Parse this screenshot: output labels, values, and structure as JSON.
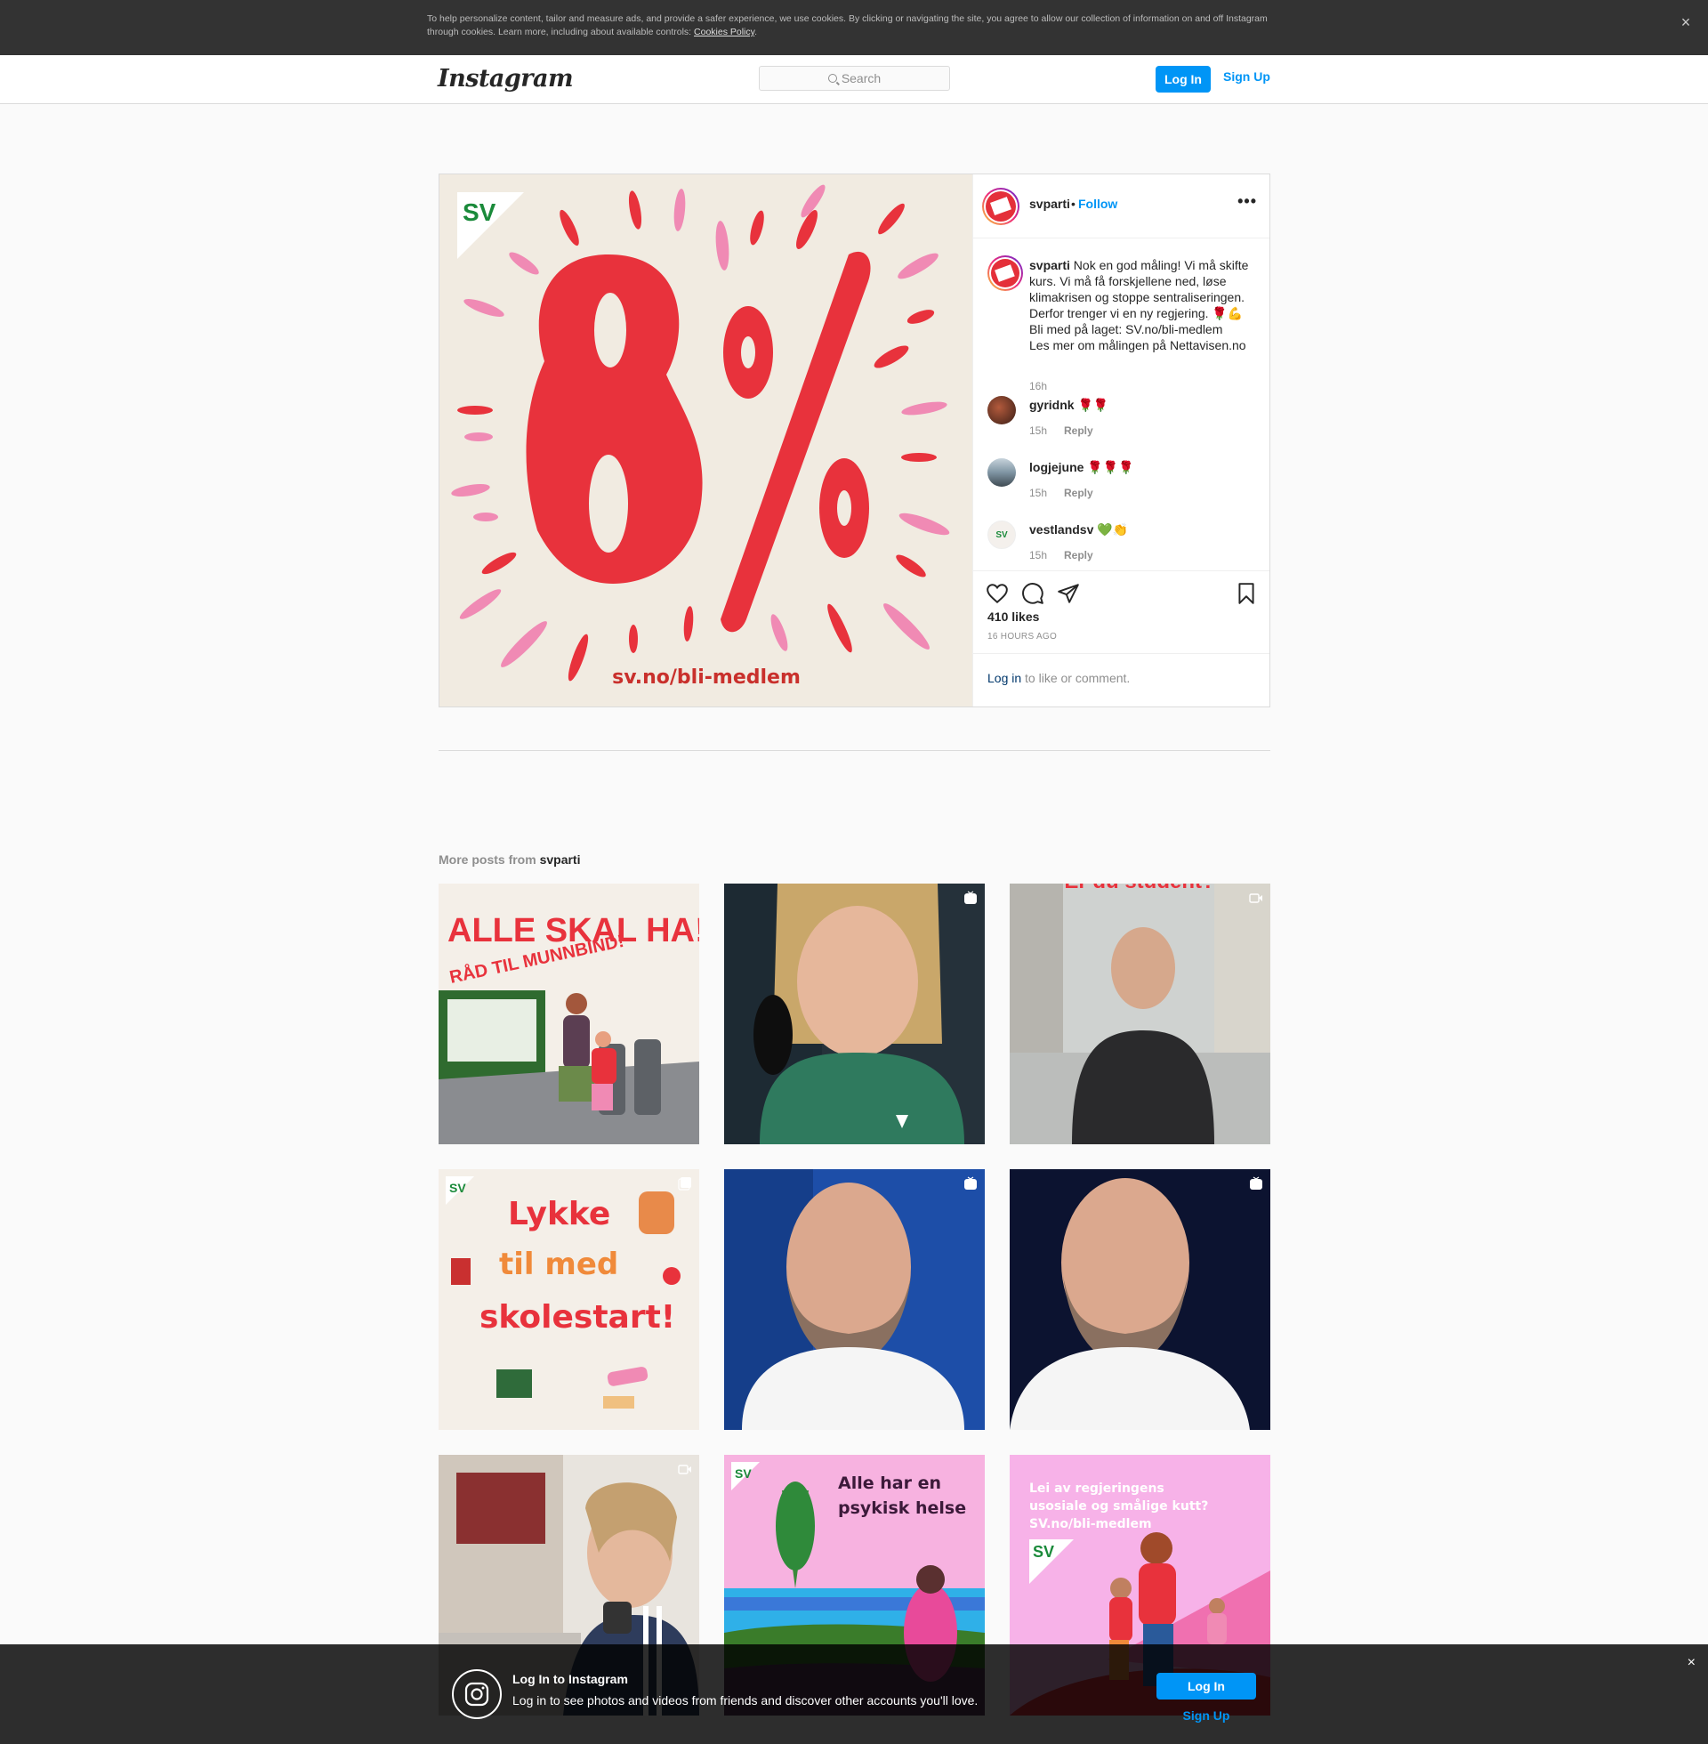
{
  "cookie_bar": {
    "text": "To help personalize content, tailor and measure ads, and provide a safer experience, we use cookies. By clicking or navigating the site, you agree to allow our collection of information on and off Instagram through cookies. Learn more, including about available controls: ",
    "link": "Cookies Policy",
    "end": ".",
    "close": "×"
  },
  "header": {
    "logo": "Instagram",
    "search_placeholder": "Search",
    "login": "Log In",
    "signup": "Sign Up"
  },
  "post": {
    "username": "svparti",
    "dot": "•",
    "follow": "Follow",
    "more": "•••",
    "image": {
      "logo_text": "SV",
      "big_text": "8%",
      "url_text": "sv.no/bli-medlem"
    },
    "caption": {
      "username": "svparti",
      "text": " Nok en god måling! Vi må skifte kurs. Vi må få forskjellene ned, løse klimakrisen og stoppe sentraliseringen. Derfor trenger vi en ny regjering. 🌹💪\nBli med på laget: SV.no/bli-medlem\nLes mer om målingen på Nettavisen.no",
      "time": "16h"
    },
    "comments": [
      {
        "username": "gyridnk",
        "text": " 🌹🌹",
        "time": "15h",
        "reply": "Reply"
      },
      {
        "username": "logjejune",
        "text": " 🌹🌹🌹",
        "time": "15h",
        "reply": "Reply"
      },
      {
        "username": "vestlandsv",
        "text": " 💚👏",
        "time": "15h",
        "reply": "Reply"
      }
    ],
    "likes": "410 likes",
    "ago": "16 HOURS AGO",
    "login_link": "Log in",
    "login_rest": " to like or comment."
  },
  "more_posts": {
    "prefix": "More posts from ",
    "username": "svparti",
    "items": [
      {
        "text1": "ALLE SKAL HA!",
        "text2": "RÅD TIL MUNNBIND!",
        "badge": ""
      },
      {
        "badge": "igtv-icon"
      },
      {
        "text1": "Er du student?",
        "badge": "video-icon"
      },
      {
        "text1": "Lykke",
        "text2": "til med",
        "text3": "skolestart!",
        "badge": "carousel-icon"
      },
      {
        "badge": "igtv-icon"
      },
      {
        "badge": "igtv-icon"
      },
      {
        "badge": "video-icon"
      },
      {
        "text1": "Alle har en",
        "text2": "psykisk helse",
        "badge": ""
      },
      {
        "text1": "Lei av regjeringens",
        "text2": "usosiale og smålige kutt?",
        "text3": "SV.no/bli-medlem",
        "badge": ""
      }
    ]
  },
  "banner": {
    "title": "Log In to Instagram",
    "subtitle": "Log in to see photos and videos from friends and discover other accounts you'll love.",
    "login": "Log In",
    "signup": "Sign Up",
    "close": "×"
  },
  "colors": {
    "accent": "#0095f6",
    "sv_red": "#e4303a",
    "sv_green": "#1a8a3a",
    "pink": "#f08ab4"
  }
}
